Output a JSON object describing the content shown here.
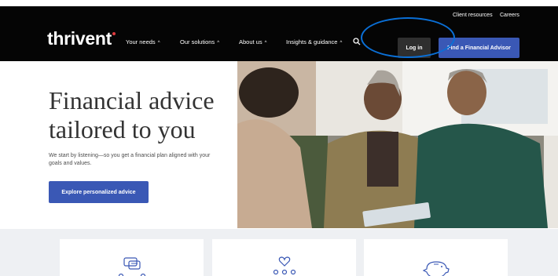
{
  "header": {
    "utility_links": [
      "Client resources",
      "Careers"
    ],
    "logo_text": "thrivent",
    "nav": [
      "Your needs",
      "Our solutions",
      "About us",
      "Insights & guidance"
    ],
    "login_label": "Log in",
    "advisor_label": "Find a Financial Advisor"
  },
  "hero": {
    "title_line1": "Financial advice",
    "title_line2": "tailored to you",
    "subtitle": "We start by listening—so you get a financial plan aligned with your goals and values.",
    "cta_label": "Explore personalized advice"
  },
  "colors": {
    "header_bg": "#050505",
    "brand_blue": "#3a58b5",
    "login_bg": "#2f2f2f",
    "annotation_circle": "#0a6fd6",
    "logo_accent": "#e03a3e"
  }
}
